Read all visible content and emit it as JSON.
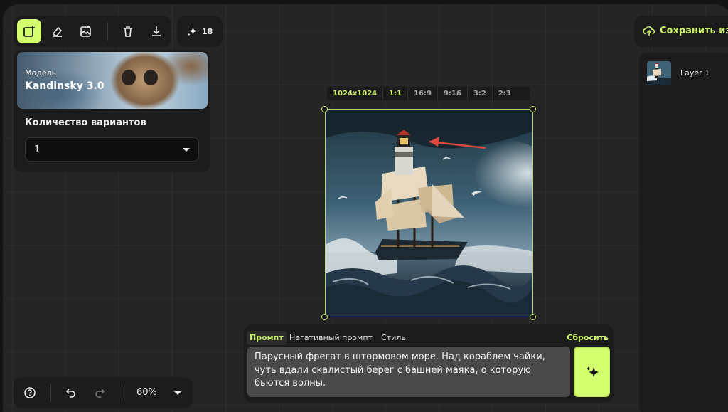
{
  "toolbar": {
    "credits": "18",
    "tools": [
      "add-image",
      "eraser",
      "image-edit",
      "delete",
      "download"
    ]
  },
  "model": {
    "label": "Модель",
    "name": "Kandinsky 3.0"
  },
  "variants": {
    "label": "Количество вариантов",
    "value": "1"
  },
  "ratio": {
    "size": "1024x1024",
    "options": [
      "1:1",
      "16:9",
      "9:16",
      "3:2",
      "2:3"
    ],
    "selected": "1:1"
  },
  "prompt": {
    "tabs": [
      "Промпт",
      "Негативный промпт",
      "Стиль"
    ],
    "active_tab": "Промпт",
    "reset_label": "Сбросить",
    "text": "Парусный фрегат в штормовом море. Над кораблем чайки, чуть вдали скалистый берег с башней маяка, о которую бьются волны."
  },
  "bottom": {
    "zoom": "60%"
  },
  "right": {
    "save_label": "Сохранить изм",
    "layer_name": "Layer 1"
  },
  "colors": {
    "accent": "#d3ff6e",
    "accent_text": "#c9ef68",
    "panel": "#1c1c1c",
    "canvas": "#252525"
  }
}
